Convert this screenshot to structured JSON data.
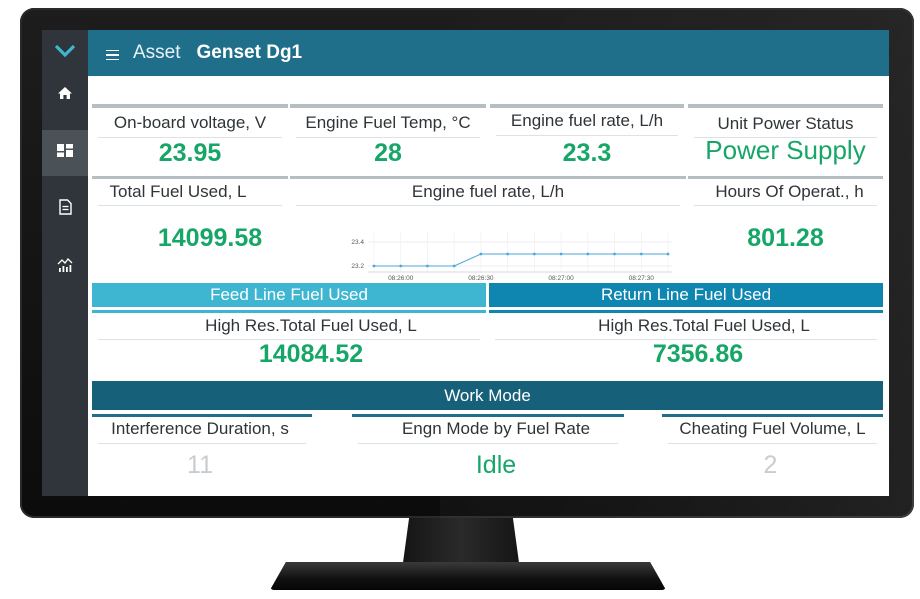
{
  "header": {
    "section": "Asset",
    "asset_name": "Genset Dg1"
  },
  "sidebar": {
    "items": [
      {
        "icon": "home-icon",
        "active": false
      },
      {
        "icon": "dashboard-icon",
        "active": true
      },
      {
        "icon": "document-icon",
        "active": false
      },
      {
        "icon": "analytics-icon",
        "active": false
      }
    ]
  },
  "tiles": {
    "voltage": {
      "label": "On-board voltage, V",
      "value": "23.95"
    },
    "fuel_temp": {
      "label": "Engine Fuel Temp, °C",
      "value": "28"
    },
    "fuel_rate": {
      "label": "Engine fuel rate, L/h",
      "value": "23.3"
    },
    "power_status": {
      "label": "Unit Power Status",
      "value": "Power Supply"
    },
    "total_fuel": {
      "label": "Total Fuel Used, L",
      "value": "14099.58"
    },
    "hours": {
      "label": "Hours Of Operat., h",
      "value": "801.28"
    },
    "feed_hr": {
      "label": "High Res.Total Fuel Used, L",
      "value": "14084.52"
    },
    "return_hr": {
      "label": "High Res.Total Fuel Used, L",
      "value": "7356.86"
    },
    "interference": {
      "label": "Interference Duration, s",
      "value": "11"
    },
    "engine_mode": {
      "label": "Engn Mode by Fuel Rate",
      "value": "Idle"
    },
    "cheating": {
      "label": "Cheating Fuel Volume, L",
      "value": "2"
    }
  },
  "bands": {
    "feed": "Feed Line Fuel Used",
    "return": "Return Line Fuel Used",
    "work_mode": "Work Mode"
  },
  "colors": {
    "accent": "#1f6f8b",
    "value_green": "#16a668",
    "feed_band": "#3fb6d1",
    "return_band": "#0f86b0",
    "work_band": "#17607a"
  },
  "chart_data": {
    "type": "line",
    "title": "Engine fuel rate, L/h",
    "x_ticks": [
      "08:26:00",
      "08:26:30",
      "08:27:00",
      "08:27:30"
    ],
    "y_ticks": [
      23.2,
      23.4
    ],
    "ylim": [
      23.15,
      23.45
    ],
    "x": [
      "08:25:50",
      "08:26:00",
      "08:26:10",
      "08:26:20",
      "08:26:30",
      "08:26:40",
      "08:26:50",
      "08:27:00",
      "08:27:10",
      "08:27:20",
      "08:27:30",
      "08:27:40"
    ],
    "values": [
      23.2,
      23.2,
      23.2,
      23.2,
      23.3,
      23.3,
      23.3,
      23.3,
      23.3,
      23.3,
      23.3,
      23.3
    ],
    "color": "#4ea7d8",
    "grid": true
  }
}
